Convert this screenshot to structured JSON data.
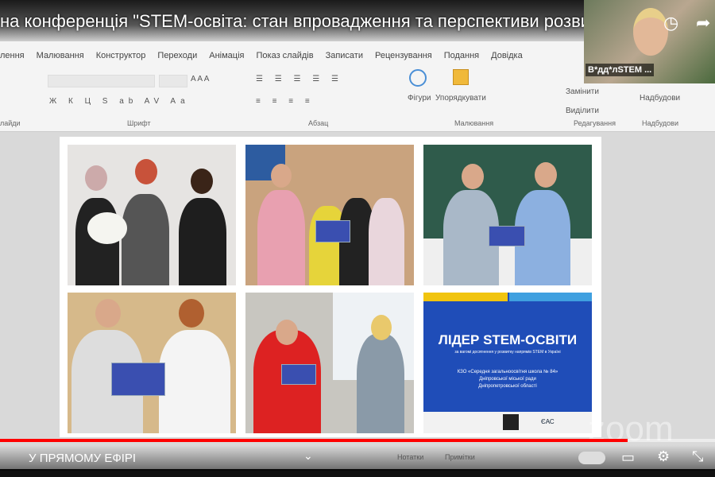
{
  "video": {
    "title": "на конференція \"STEM-освіта: стан впровадження та перспективи розвитку\"",
    "live_label": "У ПРЯМОМУ ЕФІРІ",
    "progress": 0.878,
    "zoom_watermark": "zoom"
  },
  "ribbon": {
    "tabs": [
      "лення",
      "Малювання",
      "Конструктор",
      "Переходи",
      "Анімація",
      "Показ слайдів",
      "Записати",
      "Рецензування",
      "Подання",
      "Довідка"
    ],
    "groups": [
      "лайди",
      "Шрифт",
      "Абзац",
      "Малювання",
      "Редагування",
      "Надбудови"
    ],
    "buttons": {
      "shapes": "Фігури",
      "arrange": "Упорядкувати",
      "replace": "Замінити",
      "select": "Виділити",
      "addins": "Надбудови"
    },
    "statusbar": {
      "notes": "Нотатки",
      "comments": "Примітки"
    }
  },
  "webcam": {
    "name": "В*дд*лSTEM ..."
  },
  "slide": {
    "award": {
      "title": "ЛІДЕР STEM-ОСВІТИ",
      "subtitle": "за вагомі досягнення у розвитку напрямів STEM в Україні",
      "school": "КЗО «Середня загальноосвітня школа № 84»",
      "city": "Дніпровської міської ради",
      "region": "Дніпропетровської області",
      "logo": "ЄАС"
    }
  }
}
